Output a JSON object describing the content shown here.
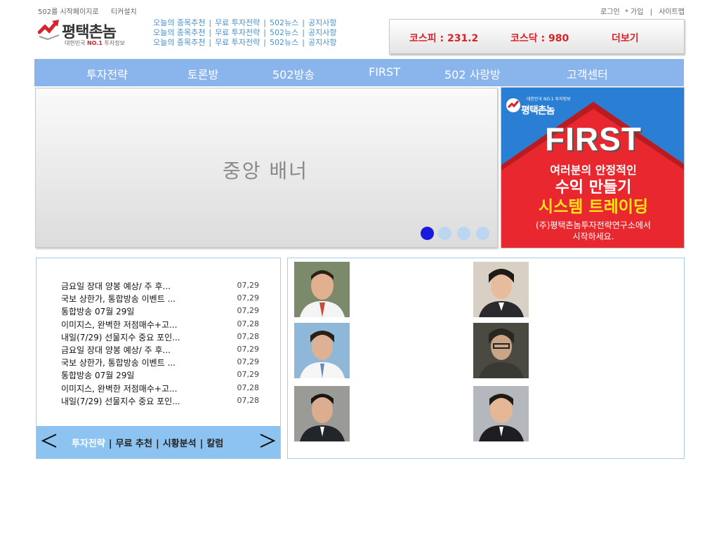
{
  "topbar": {
    "start_page": "502를 시작페이지로",
    "ticker_install": "티커설치",
    "login": "로그인",
    "join": "* 가입",
    "sep": "|",
    "sitemap": "사이트맵"
  },
  "logo": {
    "title": "평택촌놈",
    "sub_prefix": "대한민국 ",
    "sub_no1": "NO.1",
    "sub_suffix": " 투자정보"
  },
  "toplinks": [
    [
      "오늘의 종목추천",
      "무료 투자전략",
      "502뉴스",
      "공지사항"
    ],
    [
      "오늘의 종목추천",
      "무료 투자전략",
      "502뉴스",
      "공지사항"
    ],
    [
      "오늘의 종목추천",
      "무료 투자전략",
      "502뉴스",
      "공지사항"
    ]
  ],
  "ticker": {
    "kospi": "코스피 : 231.2",
    "kosdaq": "코스닥 : 980",
    "more": "더보기"
  },
  "nav": [
    "투자전략",
    "토론방",
    "502방송",
    "FIRST",
    "502 사랑방",
    "고객센터"
  ],
  "banner": {
    "label": "중앙 배너",
    "dots": 4,
    "active_dot": 0
  },
  "ad": {
    "brand_top": "대한민국 NO.1 투자정보",
    "brand": "평택촌놈",
    "headline": "FIRST",
    "line1": "여러분의 안정적인",
    "line2": "수익 만들기",
    "line3": "시스템 트레이딩",
    "line4a": "(주)평택촌놈투자전략연구소에서",
    "line4b": "시작하세요."
  },
  "news": [
    {
      "title": "금요일 장대 양봉 예상/ 주 후...",
      "date": "07,29"
    },
    {
      "title": "국보 상한가, 통합방송 이벤트 ...",
      "date": "07,29"
    },
    {
      "title": "통합방송 07월 29일",
      "date": "07,29"
    },
    {
      "title": "이미지스, 완벽한 저점매수+고...",
      "date": "07,28"
    },
    {
      "title": "내일(7/29) 선물지수 중요 포인...",
      "date": "07,28"
    },
    {
      "title": "금요일 장대 양봉 예상/ 주 후...",
      "date": "07,29"
    },
    {
      "title": "국보 상한가, 통합방송 이벤트 ...",
      "date": "07,29"
    },
    {
      "title": "통합방송 07월 29일",
      "date": "07,29"
    },
    {
      "title": "이미지스, 완벽한 저점매수+고...",
      "date": "07,28"
    },
    {
      "title": "내일(7/29) 선물지수 중요 포인...",
      "date": "07,28"
    }
  ],
  "news_tabs": {
    "tab1": "투자전략",
    "tab2": "무료 추천",
    "tab3": "시황분석",
    "tab4": "칼럼",
    "sep": "|"
  },
  "colors": {
    "nav_bg": "#8ab4ec",
    "accent_red": "#d8232a",
    "link_blue": "#4a90c7",
    "tab_bg": "#8cc3f0"
  }
}
